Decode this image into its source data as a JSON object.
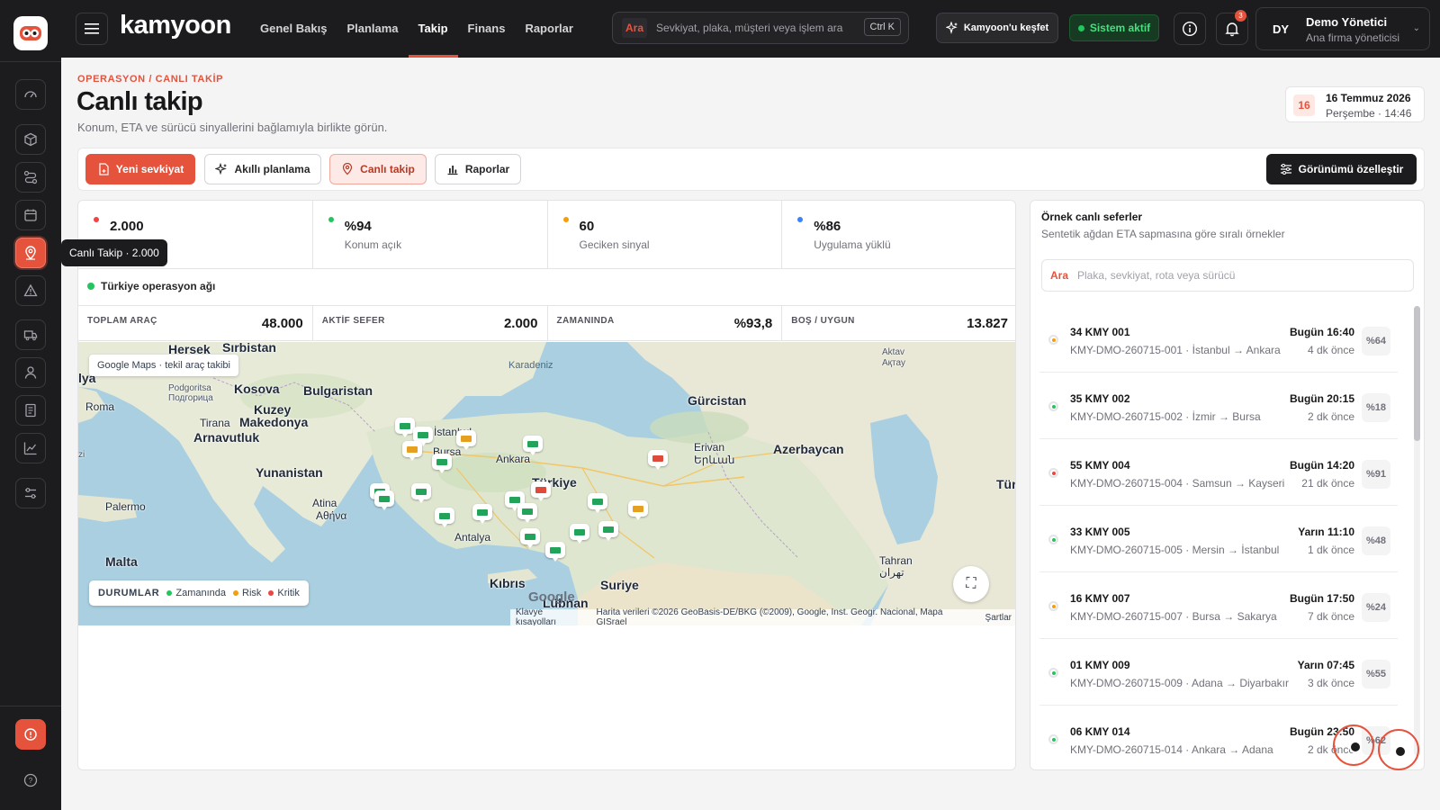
{
  "brand": {
    "name": "kamyoon"
  },
  "nav": [
    {
      "label": "Genel Bakış"
    },
    {
      "label": "Planlama"
    },
    {
      "label": "Takip"
    },
    {
      "label": "Finans"
    },
    {
      "label": "Raporlar"
    }
  ],
  "nav_active": "Takip",
  "search": {
    "tag": "Ara",
    "placeholder": "Sevkiyat, plaka, müşteri veya işlem ara",
    "shortcut": "Ctrl K"
  },
  "discover_label": "Kamyoon'u keşfet",
  "system_status": "Sistem aktif",
  "notifications": {
    "count": "3"
  },
  "user": {
    "initials": "DY",
    "name": "Demo Yönetici",
    "role": "Ana firma yöneticisi"
  },
  "sidebar": {
    "items": [
      {
        "name": "gauge-icon"
      },
      {
        "name": "package-icon"
      },
      {
        "name": "route-icon"
      },
      {
        "name": "calendar-icon"
      },
      {
        "name": "map-pin-icon",
        "active": true
      },
      {
        "name": "alert-icon"
      },
      {
        "name": "truck-icon"
      },
      {
        "name": "user-icon"
      },
      {
        "name": "document-icon"
      },
      {
        "name": "chart-icon"
      },
      {
        "name": "sliders-icon"
      }
    ],
    "tooltip": "Canlı Takip · 2.000"
  },
  "header": {
    "breadcrumb": "OPERASYON / CANLI TAKİP",
    "title": "Canlı takip",
    "subtitle": "Konum, ETA ve sürücü sinyallerini bağlamıyla birlikte görün.",
    "date_day": "16",
    "date_line1": "16 Temmuz 2026",
    "date_line2": "Perşembe · 14:46"
  },
  "toolbar": {
    "new_shipment": "Yeni sevkiyat",
    "smart_planning": "Akıllı planlama",
    "live_tracking": "Canlı takip",
    "reports": "Raporlar",
    "customize": "Görünümü özelleştir"
  },
  "kpis": [
    {
      "value": "2.000",
      "label": "",
      "color": "#ef4444"
    },
    {
      "value": "%94",
      "label": "Konum açık",
      "color": "#22c55e"
    },
    {
      "value": "60",
      "label": "Geciken sinyal",
      "color": "#f59e0b"
    },
    {
      "value": "%86",
      "label": "Uygulama yüklü",
      "color": "#3b82f6"
    }
  ],
  "network_label": "Türkiye operasyon ağı",
  "stats": [
    {
      "label": "TOPLAM ARAÇ",
      "value": "48.000"
    },
    {
      "label": "AKTİF SEFER",
      "value": "2.000"
    },
    {
      "label": "ZAMANINDA",
      "value": "%93,8"
    },
    {
      "label": "BOŞ / UYGUN",
      "value": "13.827"
    }
  ],
  "map": {
    "chip": "Google Maps · tekil araç takibi",
    "labels": {
      "hersek": "Hersek",
      "sirbistan": "Sırbistan",
      "bulgaristan": "Bulgaristan",
      "roma": "Roma",
      "kosova": "Kosova",
      "podgoritsa": "Podgoritsa",
      "podgoritsa_cyr": "Подгорица",
      "kuzey_makedonya": "Kuzey",
      "makedonya": "Makedonya",
      "tirana": "Tirana",
      "arnavutluk": "Arnavutluk",
      "yunanistan": "Yunanistan",
      "palermo": "Palermo",
      "atina": "Atina",
      "atina_gr": "Αθήνα",
      "malta": "Malta",
      "kibris": "Kıbrıs",
      "suriye": "Suriye",
      "lubnan": "Lübnan",
      "ankara": "Ankara",
      "antalya": "Antalya",
      "turkiye": "Türkiye",
      "bursa": "Bursa",
      "istanbul": "İstanbul",
      "karadeniz": "Karadeniz",
      "gurcistan": "Gürcistan",
      "erivan": "Erivan",
      "erivan_arm": "Երևան",
      "azerbaycan": "Azerbaycan",
      "tahran": "Tahran",
      "tahran_fa": "تهران",
      "aktau": "Aktav",
      "aktau_kz": "Ақтау",
      "turk": "Türk",
      "izi": "zi",
      "italya": "lya"
    },
    "legend_title": "DURUMLAR",
    "legend": [
      {
        "label": "Zamanında",
        "color": "#22c55e"
      },
      {
        "label": "Risk",
        "color": "#f59e0b"
      },
      {
        "label": "Kritik",
        "color": "#ef4444"
      }
    ],
    "attribution": [
      "Klavye kısayolları",
      "Harita verileri ©2026 GeoBasis-DE/BKG (©2009), Google, Inst. Geogr. Nacional, Mapa GISrael",
      "Şartlar"
    ],
    "google": "Google",
    "truck_colors": {
      "ok": "#22a35a",
      "risk": "#e6a020",
      "critical": "#e04a3a"
    }
  },
  "right_panel": {
    "title": "Örnek canlı seferler",
    "subtitle": "Sentetik ağdan ETA sapmasına göre sıralı örnekler",
    "search_tag": "Ara",
    "search_placeholder": "Plaka, sevkiyat, rota veya sürücü",
    "trips": [
      {
        "plate": "34 KMY 001",
        "route": "KMY-DMO-260715-001 · İstanbul → Ankara",
        "eta": "Bugün 16:40",
        "ago": "4 dk önce",
        "pct": "%64",
        "status": "o"
      },
      {
        "plate": "35 KMY 002",
        "route": "KMY-DMO-260715-002 · İzmir → Bursa",
        "eta": "Bugün 20:15",
        "ago": "2 dk önce",
        "pct": "%18",
        "status": "g"
      },
      {
        "plate": "55 KMY 004",
        "route": "KMY-DMO-260715-004 · Samsun → Kayseri",
        "eta": "Bugün 14:20",
        "ago": "21 dk önce",
        "pct": "%91",
        "status": "r"
      },
      {
        "plate": "33 KMY 005",
        "route": "KMY-DMO-260715-005 · Mersin → İstanbul",
        "eta": "Yarın 11:10",
        "ago": "1 dk önce",
        "pct": "%48",
        "status": "g"
      },
      {
        "plate": "16 KMY 007",
        "route": "KMY-DMO-260715-007 · Bursa → Sakarya",
        "eta": "Bugün 17:50",
        "ago": "7 dk önce",
        "pct": "%24",
        "status": "o"
      },
      {
        "plate": "01 KMY 009",
        "route": "KMY-DMO-260715-009 · Adana → Diyarbakır",
        "eta": "Yarın 07:45",
        "ago": "3 dk önce",
        "pct": "%55",
        "status": "g"
      },
      {
        "plate": "06 KMY 014",
        "route": "KMY-DMO-260715-014 · Ankara → Adana",
        "eta": "Bugün 23:50",
        "ago": "2 dk önce",
        "pct": "%62",
        "status": "g"
      }
    ]
  }
}
